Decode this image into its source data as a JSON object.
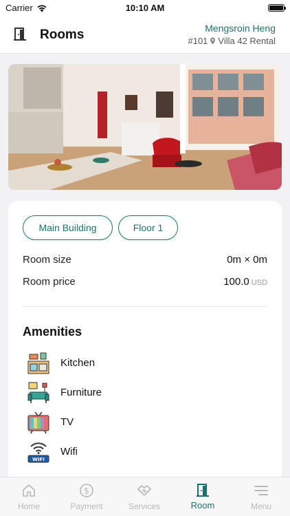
{
  "status_bar": {
    "carrier": "Carrier",
    "time": "10:10 AM"
  },
  "header": {
    "title": "Rooms",
    "user_name": "Mengsroin Heng",
    "room_number": "#101",
    "property": "Villa 42 Rental"
  },
  "hero": {
    "icon": "room-photo"
  },
  "details": {
    "building": "Main Building",
    "floor": "Floor 1",
    "size_label": "Room size",
    "size_value": "0m × 0m",
    "price_label": "Room price",
    "price_value": "100.0",
    "price_unit": "USD"
  },
  "amenities": {
    "title": "Amenities",
    "items": [
      {
        "label": "Kitchen",
        "icon": "kitchen-icon"
      },
      {
        "label": "Furniture",
        "icon": "sofa-icon"
      },
      {
        "label": "TV",
        "icon": "tv-icon"
      },
      {
        "label": "Wifi",
        "icon": "wifi-icon"
      }
    ]
  },
  "tabbar": {
    "items": [
      {
        "label": "Home",
        "icon": "home-icon"
      },
      {
        "label": "Payment",
        "icon": "dollar-icon"
      },
      {
        "label": "Services",
        "icon": "handshake-icon"
      },
      {
        "label": "Room",
        "icon": "door-icon",
        "active": true
      },
      {
        "label": "Menu",
        "icon": "menu-icon"
      }
    ]
  },
  "colors": {
    "accent": "#1f6f6b",
    "inactive": "#b8b8bb",
    "background": "#f2f2f4"
  }
}
